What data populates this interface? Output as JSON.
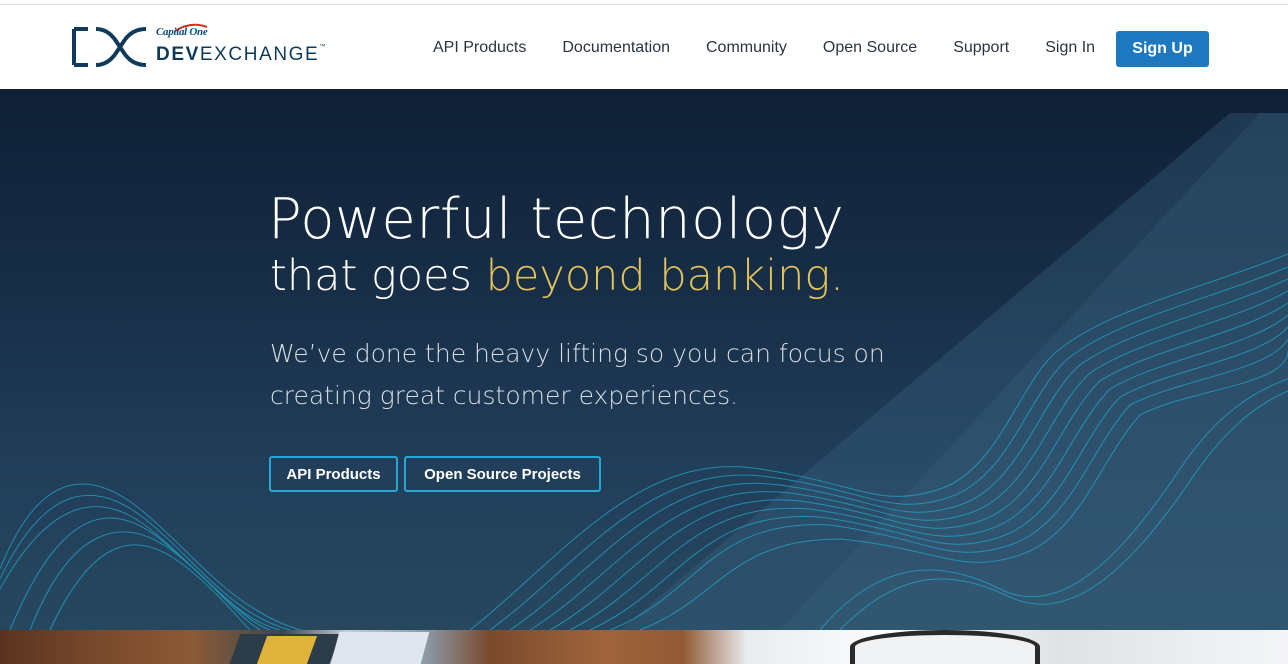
{
  "brand": {
    "parent": "Capital One",
    "name_bold": "DEV",
    "name_light": "EXCHANGE",
    "trademark": "™"
  },
  "nav": {
    "items": [
      {
        "label": "API Products"
      },
      {
        "label": "Documentation"
      },
      {
        "label": "Community"
      },
      {
        "label": "Open Source"
      },
      {
        "label": "Support"
      },
      {
        "label": "Sign In"
      }
    ],
    "signup_label": "Sign Up"
  },
  "hero": {
    "headline_line1": "Powerful technology",
    "headline_line2_plain": "that goes ",
    "headline_line2_accent": "beyond banking.",
    "subtext": "We’ve done the heavy lifting so you can focus on creating great customer experiences.",
    "buttons": {
      "api_products": "API Products",
      "open_source_projects": "Open Source Projects"
    }
  },
  "colors": {
    "primary_button": "#1e78bf",
    "accent_text": "#e2c35a",
    "outline_button": "#25a8d6",
    "hero_background": "#172d46"
  },
  "icons": {
    "logo_mark": "dx-logo-icon",
    "wave_pattern": "wave-lines-decoration"
  }
}
